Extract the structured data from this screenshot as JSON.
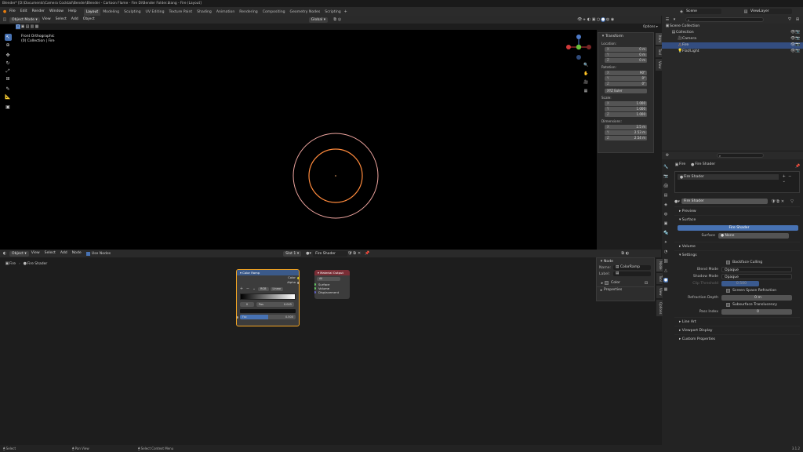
{
  "window_title": "Blender* [D:\\Documents\\Camera Cocktail\\Bender\\Blender - Cartoon Flame - Fire Di\\Bender Folder.blang - Fire (Layout]",
  "menu": [
    "File",
    "Edit",
    "Render",
    "Window",
    "Help"
  ],
  "workspace_tabs": [
    {
      "label": "Layout",
      "active": true
    },
    {
      "label": "Modeling"
    },
    {
      "label": "Sculpting"
    },
    {
      "label": "UV Editing"
    },
    {
      "label": "Texture Paint"
    },
    {
      "label": "Shading"
    },
    {
      "label": "Animation"
    },
    {
      "label": "Rendering"
    },
    {
      "label": "Compositing"
    },
    {
      "label": "Geometry Nodes"
    },
    {
      "label": "Scripting"
    }
  ],
  "scene_field": "Scene",
  "view_layer_field": "ViewLayer",
  "viewport": {
    "mode": "Object Mode",
    "menus": [
      "View",
      "Select",
      "Add",
      "Object"
    ],
    "transform_orientation": "Global",
    "overlay_title": "Front Orthographic",
    "overlay_sub": "(0) Collection | Fire",
    "options_label": "Options"
  },
  "npanel": {
    "header": "Transform",
    "location_label": "Location:",
    "location": [
      {
        "axis": "X",
        "value": "0 m"
      },
      {
        "axis": "Y",
        "value": "0 m"
      },
      {
        "axis": "Z",
        "value": "0 m"
      }
    ],
    "rotation_label": "Rotation:",
    "rotation": [
      {
        "axis": "X",
        "value": "90°"
      },
      {
        "axis": "Y",
        "value": "0°"
      },
      {
        "axis": "Z",
        "value": "0°"
      }
    ],
    "rotation_mode": "XYZ Euler",
    "scale_label": "Scale:",
    "scale": [
      {
        "axis": "X",
        "value": "1.000"
      },
      {
        "axis": "Y",
        "value": "1.000"
      },
      {
        "axis": "Z",
        "value": "1.000"
      }
    ],
    "dimensions_label": "Dimensions:",
    "dimensions": [
      {
        "axis": "X",
        "value": "2.5 m"
      },
      {
        "axis": "Y",
        "value": "2.53 m"
      },
      {
        "axis": "Z",
        "value": "2.54 m"
      }
    ],
    "tabs": [
      "Item",
      "Tool",
      "View"
    ]
  },
  "outliner": {
    "search_placeholder": "",
    "rows": [
      {
        "label": "Scene Collection",
        "indent": 0
      },
      {
        "label": "Collection",
        "indent": 1
      },
      {
        "label": "Camera",
        "indent": 2
      },
      {
        "label": "Fire",
        "indent": 2,
        "selected": true
      },
      {
        "label": "Flat/Light",
        "indent": 2
      }
    ]
  },
  "properties": {
    "object_name": "Fire",
    "material_name": "Fire Shader",
    "slot_label": "Fire Shader",
    "material_field": "Fire Shader",
    "sections_top": [
      "Preview",
      "Surface"
    ],
    "surface_button": "Fire Shader",
    "surface_label": "Surface",
    "surface_value": "None",
    "volume": "Volume",
    "settings": "Settings",
    "backface_culling": "Backface Culling",
    "blend_mode_label": "Blend Mode",
    "blend_mode_value": "Opaque",
    "shadow_mode_label": "Shadow Mode",
    "shadow_mode_value": "Opaque",
    "clip_threshold_label": "Clip Threshold",
    "clip_threshold_value": "0.500",
    "screen_space_refraction": "Screen Space Refraction",
    "refraction_depth_label": "Refraction Depth",
    "refraction_depth_value": "0 m",
    "subsurface_translucency": "Subsurface Translucency",
    "pass_index_label": "Pass Index",
    "pass_index_value": "0",
    "collapsed_sections": [
      "Line Art",
      "Viewport Display",
      "Custom Properties"
    ]
  },
  "node_editor": {
    "mode": "Object",
    "menus": [
      "View",
      "Select",
      "Add",
      "Node"
    ],
    "use_nodes": "Use Nodes",
    "slot": "Slot 1",
    "material": "Fire Shader",
    "breadcrumb_object": "Fire",
    "breadcrumb_material": "Fire Shader",
    "color_ramp": {
      "title": "Color Ramp",
      "out_color": "Color",
      "out_alpha": "Alpha",
      "mode": "RGB",
      "interp": "Linear",
      "pos_index": "0",
      "pos_label": "Pos",
      "pos_value": "0.045",
      "fac_label": "Fac",
      "fac_value": "0.500"
    },
    "material_output": {
      "title": "Material Output",
      "target": "All",
      "inputs": [
        "Surface",
        "Volume",
        "Displacement"
      ]
    }
  },
  "node_sidebar": {
    "header": "Node",
    "name_label": "Name:",
    "name_value": "ColorRamp",
    "label_label": "Label:",
    "label_value": "",
    "color_label": "Color",
    "properties": "Properties",
    "tabs": [
      "Node",
      "Tool",
      "View",
      "Options"
    ]
  },
  "status": {
    "left": "Select",
    "middle": "Pan View",
    "right": "Select Context Menu",
    "version": "3.1.2"
  }
}
